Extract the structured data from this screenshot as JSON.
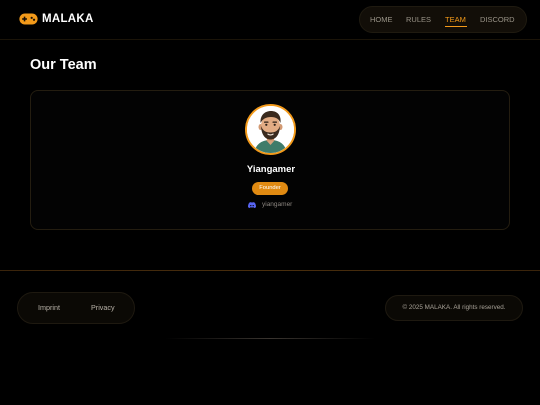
{
  "header": {
    "brand": {
      "name": "MALAKA",
      "logo_icon": "gamepad-icon",
      "accent": "#f39a1a"
    },
    "nav": [
      {
        "label": "HOME",
        "active": false
      },
      {
        "label": "RULES",
        "active": false
      },
      {
        "label": "TEAM",
        "active": true
      },
      {
        "label": "DISCORD",
        "active": false
      }
    ]
  },
  "main": {
    "title": "Our Team",
    "members": [
      {
        "name": "Yiangamer",
        "role": "Founder",
        "discord_icon": "discord-icon",
        "discord_handle": "yiangamer",
        "avatar_icon": "bearded-man-avatar"
      }
    ]
  },
  "footer": {
    "links": [
      "Imprint",
      "Privacy"
    ],
    "copyright": "© 2025 MALAKA. All rights reserved."
  },
  "colors": {
    "background": "#000000",
    "accent": "#f39a1a",
    "badge": "#e08a12",
    "muted_text": "#9a9488"
  }
}
